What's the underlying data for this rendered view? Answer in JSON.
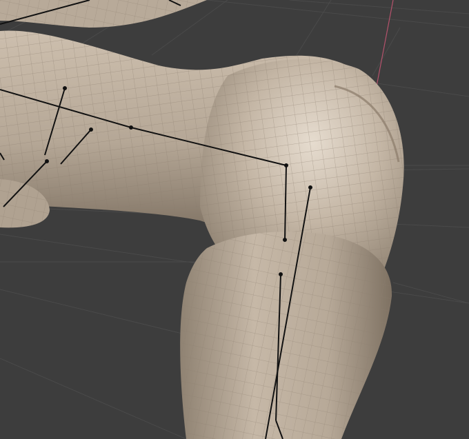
{
  "viewport": {
    "background_color": "#3d3d3d",
    "grid_color": "#4a4a4a",
    "grid_axis_color": "#b5526c",
    "mesh_base_color": "#b3a493",
    "mesh_light_color": "#e6dccf",
    "mesh_shadow_color": "#7c6f60",
    "wireframe_color": "#8a7d6e",
    "armature_color": "#111111",
    "show_grid": true,
    "show_wireframe": true,
    "show_armature": true,
    "object": "body-mesh-leg-hip-closeup"
  }
}
